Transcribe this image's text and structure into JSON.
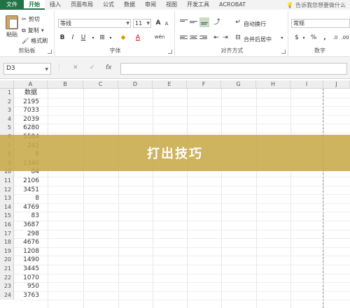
{
  "tabs": [
    "文件",
    "开始",
    "插入",
    "页面布局",
    "公式",
    "数据",
    "审阅",
    "视图",
    "开发工具",
    "ACROBAT"
  ],
  "tell_me": "告诉我您想要做什么",
  "clipboard": {
    "paste": "粘贴",
    "cut": "剪切",
    "copy": "复制",
    "format_painter": "格式刷",
    "label": "剪贴板"
  },
  "font": {
    "name": "等线",
    "size": "11",
    "bold": "B",
    "italic": "I",
    "underline": "U",
    "grow": "A",
    "shrink": "A",
    "color_a": "A",
    "wen": "wén",
    "label": "字体"
  },
  "alignment": {
    "wrap": "自动换行",
    "merge": "合并后居中",
    "label": "对齐方式"
  },
  "number": {
    "format": "常规",
    "percent": "%",
    "comma": ",",
    "label": "数字"
  },
  "formula_bar": {
    "name_box": "D3",
    "cancel": "✕",
    "enter": "✓",
    "fx": "fx",
    "value": ""
  },
  "columns": [
    "A",
    "B",
    "C",
    "D",
    "E",
    "F",
    "G",
    "H",
    "I",
    "J"
  ],
  "rows": [
    {
      "n": "1",
      "a": "数据"
    },
    {
      "n": "2",
      "a": "2195"
    },
    {
      "n": "3",
      "a": "7033"
    },
    {
      "n": "4",
      "a": "2039"
    },
    {
      "n": "5",
      "a": "6280"
    },
    {
      "n": "6",
      "a": "5584"
    },
    {
      "n": "7",
      "a": "241"
    },
    {
      "n": "8",
      "a": "8"
    },
    {
      "n": "9",
      "a": "1340"
    },
    {
      "n": "10",
      "a": "84"
    },
    {
      "n": "11",
      "a": "2106"
    },
    {
      "n": "12",
      "a": "3451"
    },
    {
      "n": "13",
      "a": "8"
    },
    {
      "n": "14",
      "a": "4769"
    },
    {
      "n": "15",
      "a": "83"
    },
    {
      "n": "16",
      "a": "3687"
    },
    {
      "n": "17",
      "a": "298"
    },
    {
      "n": "18",
      "a": "4676"
    },
    {
      "n": "19",
      "a": "1208"
    },
    {
      "n": "20",
      "a": "1490"
    },
    {
      "n": "21",
      "a": "3445"
    },
    {
      "n": "22",
      "a": "1070"
    },
    {
      "n": "23",
      "a": "950"
    },
    {
      "n": "24",
      "a": "3763"
    }
  ],
  "banner": "打出技巧",
  "colors": {
    "excel_green": "#217346",
    "banner": "#c7aa49"
  }
}
